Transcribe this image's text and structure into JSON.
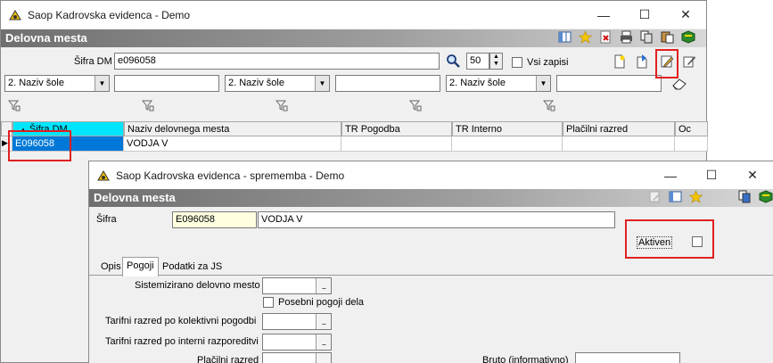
{
  "main_window": {
    "title": "Saop Kadrovska evidenca - Demo",
    "header": "Delovna mesta",
    "sifra_label": "Šifra DM",
    "sifra_value": "e096058",
    "count_value": "50",
    "vsi_zapisi_label": "Vsi zapisi",
    "filter_combos": [
      "2. Naziv šole",
      "2. Naziv šole",
      "2. Naziv šole"
    ],
    "columns": [
      "Šifra DM",
      "Naziv delovnega mesta",
      "TR Pogodba",
      "TR Interno",
      "Plačilni razred",
      "Oc"
    ],
    "rows": [
      {
        "sifra": "E096058",
        "naziv": "VODJA V",
        "tr_pogodba": "",
        "tr_interno": "",
        "placilni": ""
      }
    ]
  },
  "edit_window": {
    "title": "Saop Kadrovska evidenca - sprememba - Demo",
    "header": "Delovna mesta",
    "sifra_label": "Šifra",
    "sifra_value": "E096058",
    "naziv_value": "VODJA V",
    "aktiven_label": "Aktiven",
    "tabs": [
      "Opis",
      "Pogoji",
      "Podatki za JS"
    ],
    "active_tab": "Pogoji",
    "form": {
      "sistemizirano_label": "Sistemizirano delovno mesto",
      "posebni_pogoji_label": "Posebni pogoji dela",
      "tarifni_kolektivni_label": "Tarifni razred po kolektivni pogodbi",
      "tarifni_interni_label": "Tarifni razred po interni razporeditvi",
      "placilni_label": "Plačilni razred",
      "bruto_label": "Bruto (informativno)",
      "dots": "..."
    }
  },
  "window_buttons": {
    "minimize": "—",
    "maximize": "☐",
    "close": "✕"
  },
  "colors": {
    "selected_row": "#0078d7",
    "sort_header": "#00e5ff",
    "highlight_box": "#e02020",
    "sifra_field_bg": "#ffffe0"
  }
}
